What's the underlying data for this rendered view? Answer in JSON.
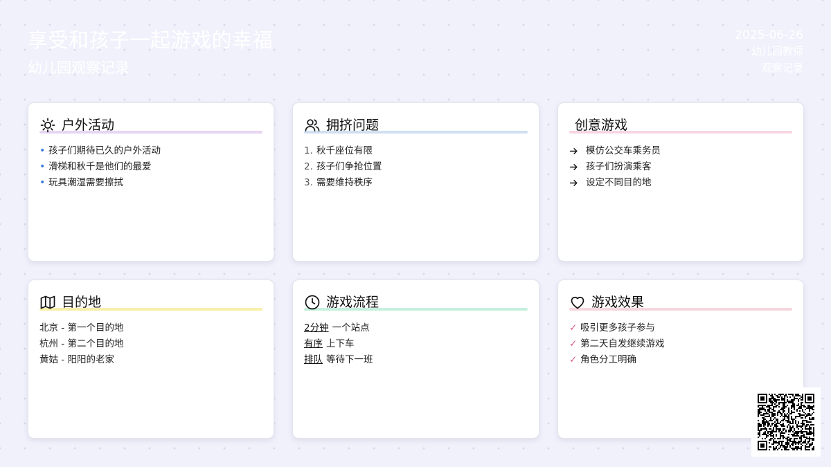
{
  "header": {
    "title": "享受和孩子一起游戏的幸福",
    "subtitle": "幼儿园观察记录"
  },
  "meta": {
    "date": "2025-06-26",
    "author": "幼儿园教师",
    "doc_type": "观察记录"
  },
  "cards": [
    {
      "title": "户外活动",
      "icon": "sun-icon",
      "accent": "#e8d4f4",
      "style": "bullet",
      "items": [
        "孩子们期待已久的户外活动",
        "滑梯和秋千是他们的最爱",
        "玩具潮湿需要擦拭"
      ]
    },
    {
      "title": "拥挤问题",
      "icon": "users-icon",
      "accent": "#cfe0f2",
      "style": "numbered",
      "items": [
        {
          "marker": "1.",
          "text": "秋千座位有限"
        },
        {
          "marker": "2.",
          "text": "孩子们争抢位置"
        },
        {
          "marker": "3.",
          "text": "需要维持秩序"
        }
      ]
    },
    {
      "title": "创意游戏",
      "icon": "",
      "accent": "#f7d5e3",
      "style": "arrow",
      "items": [
        "模仿公交车乘务员",
        "孩子们扮演乘客",
        "设定不同目的地"
      ]
    },
    {
      "title": "目的地",
      "icon": "map-icon",
      "accent": "#f8efa9",
      "style": "plain",
      "items": [
        "北京 - 第一个目的地",
        "杭州 - 第二个目的地",
        "黄姑 - 阳阳的老家"
      ]
    },
    {
      "title": "游戏流程",
      "icon": "clock-icon",
      "accent": "#c6f0de",
      "style": "keyword",
      "items": [
        {
          "key": "2分钟",
          "text": "一个站点"
        },
        {
          "key": "有序",
          "text": "上下车"
        },
        {
          "key": "排队",
          "text": "等待下一班"
        }
      ]
    },
    {
      "title": "游戏效果",
      "icon": "heart-icon",
      "accent": "#f6d7dd",
      "style": "check",
      "items": [
        "吸引更多孩子参与",
        "第二天自发继续游戏",
        "角色分工明确"
      ]
    }
  ],
  "glyphs": {
    "bullet": "•",
    "check": "✓"
  },
  "qr": {
    "icon": "qr-code-icon"
  }
}
